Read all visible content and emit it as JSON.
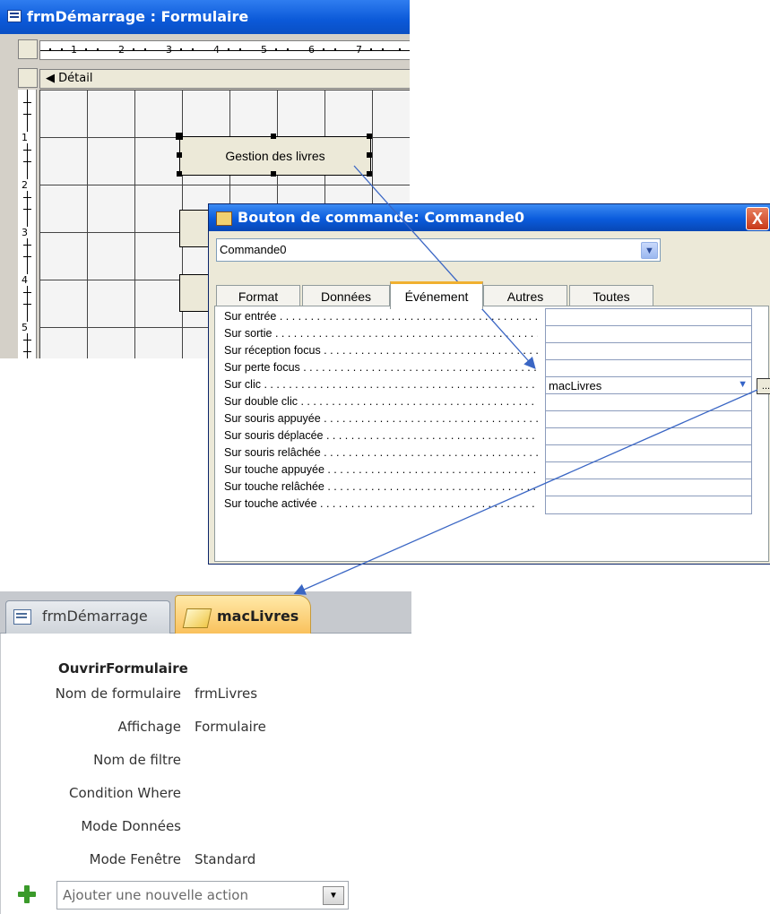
{
  "form_window": {
    "title": "frmDémarrage : Formulaire",
    "ruler_numbers": [
      "1",
      "2",
      "3",
      "4",
      "5",
      "6",
      "7"
    ],
    "vertical_ruler_numbers": [
      "1",
      "2",
      "3",
      "4",
      "5"
    ],
    "section_label": "Détail",
    "button_caption": "Gestion des livres"
  },
  "property_sheet": {
    "title": "Bouton de commande: Commande0",
    "close_label": "X",
    "object_selector": "Commande0",
    "tabs": [
      "Format",
      "Données",
      "Événement",
      "Autres",
      "Toutes"
    ],
    "active_tab": "Événement",
    "events": [
      {
        "label": "Sur entrée",
        "value": ""
      },
      {
        "label": "Sur sortie",
        "value": ""
      },
      {
        "label": "Sur réception focus",
        "value": ""
      },
      {
        "label": "Sur perte focus",
        "value": ""
      },
      {
        "label": "Sur clic",
        "value": "macLivres"
      },
      {
        "label": "Sur double clic",
        "value": ""
      },
      {
        "label": "Sur souris appuyée",
        "value": ""
      },
      {
        "label": "Sur souris déplacée",
        "value": ""
      },
      {
        "label": "Sur souris relâchée",
        "value": ""
      },
      {
        "label": "Sur touche appuyée",
        "value": ""
      },
      {
        "label": "Sur touche relâchée",
        "value": ""
      },
      {
        "label": "Sur touche activée",
        "value": ""
      }
    ],
    "build_button": "..."
  },
  "macro_editor": {
    "tabs": [
      {
        "label": "frmDémarrage",
        "icon": "form-icon",
        "active": false
      },
      {
        "label": "macLivres",
        "icon": "macro-icon",
        "active": true
      }
    ],
    "action": "OuvrirFormulaire",
    "arguments": [
      {
        "label": "Nom de formulaire",
        "value": "frmLivres"
      },
      {
        "label": "Affichage",
        "value": "Formulaire"
      },
      {
        "label": "Nom de filtre",
        "value": ""
      },
      {
        "label": "Condition Where",
        "value": ""
      },
      {
        "label": "Mode Données",
        "value": ""
      },
      {
        "label": "Mode Fenêtre",
        "value": "Standard"
      }
    ],
    "add_action_placeholder": "Ajouter une nouvelle action"
  },
  "colors": {
    "xp_titlebar": "#0b59d8",
    "arrow": "#3a66c4",
    "active_tab": "#f9c05a"
  }
}
